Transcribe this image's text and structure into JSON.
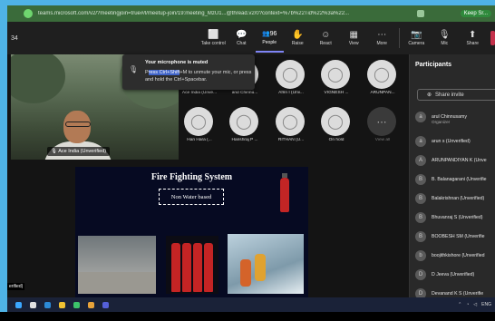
{
  "browser": {
    "url": "teams.microsoft.com/v2/?meetingjoin=true#/l/meetup-join/19:meeting_MzU1...@thread.v2/0?context=%7b%22Tid%22%3a%22...",
    "profile_label": "Keep Sr..."
  },
  "meeting": {
    "timer": "34",
    "toolbar": [
      {
        "icon": "share-tray-icon",
        "glyph": "⬜",
        "label": "Take control"
      },
      {
        "icon": "chat-icon",
        "glyph": "💬",
        "label": "Chat"
      },
      {
        "icon": "people-icon",
        "glyph": "👥",
        "label": "People",
        "count": "96",
        "active": true
      },
      {
        "icon": "raise-hand-icon",
        "glyph": "✋",
        "label": "Raise"
      },
      {
        "icon": "react-icon",
        "glyph": "☺",
        "label": "React"
      },
      {
        "icon": "view-icon",
        "glyph": "▦",
        "label": "View"
      },
      {
        "icon": "more-icon",
        "glyph": "⋯",
        "label": "More"
      },
      {
        "icon": "camera-icon",
        "glyph": "📷",
        "label": "Camera"
      },
      {
        "icon": "mic-icon",
        "glyph": "🎙",
        "label": "Mic"
      },
      {
        "icon": "share-icon",
        "glyph": "⬆",
        "label": "Share"
      }
    ]
  },
  "video": {
    "label": "Ace India (Unverified)"
  },
  "toast": {
    "title": "Your microphone is muted",
    "body_pre": "P",
    "body_hl": "ress Ctrl+Shift",
    "body_post": "+M to unmute your mic, or press and hold the Ctrl+Spacebar."
  },
  "tiles": [
    {
      "name": "Ace India (Unve...",
      "dark": false
    },
    {
      "name": "and Chinnu...",
      "dark": false
    },
    {
      "name": "Afrin I (Unv...",
      "dark": false
    },
    {
      "name": "VIGNESH ...",
      "dark": false
    },
    {
      "name": "ARUNPAN...",
      "dark": false
    },
    {
      "name": "Hari Hara (...",
      "dark": false
    },
    {
      "name": "Harishraj P ...",
      "dark": false
    },
    {
      "name": "RITHAN (U...",
      "dark": false
    },
    {
      "name": "On hold",
      "dark": false
    },
    {
      "name": "View all",
      "dark": true
    }
  ],
  "slide": {
    "title": "Fire Fighting System",
    "box_text": "Non Water based"
  },
  "side_tag": "erified)",
  "participants": {
    "header": "Participants",
    "invite_label": "Share invite",
    "list": [
      {
        "name": "arul Chinnusamy",
        "role": "Organizer",
        "initial": "a"
      },
      {
        "name": "arun s (Unverified)",
        "role": "",
        "initial": "a"
      },
      {
        "name": "ARUNPANDIYAN K (Unve",
        "role": "",
        "initial": "A"
      },
      {
        "name": "B. Balanagarani (Unverifie",
        "role": "",
        "initial": "B"
      },
      {
        "name": "Balakrishnan (Unverified)",
        "role": "",
        "initial": "B"
      },
      {
        "name": "Bhuvanraj S (Unverified)",
        "role": "",
        "initial": "B"
      },
      {
        "name": "BOOBESH SM (Unverifie",
        "role": "",
        "initial": "B"
      },
      {
        "name": "boojithkishore (Unverified",
        "role": "",
        "initial": "b"
      },
      {
        "name": "D Jeeva (Unverified)",
        "role": "",
        "initial": "D"
      },
      {
        "name": "Devanand K S (Unverifie",
        "role": "",
        "initial": "D"
      }
    ]
  },
  "taskbar": {
    "tray_text": "ENG"
  }
}
